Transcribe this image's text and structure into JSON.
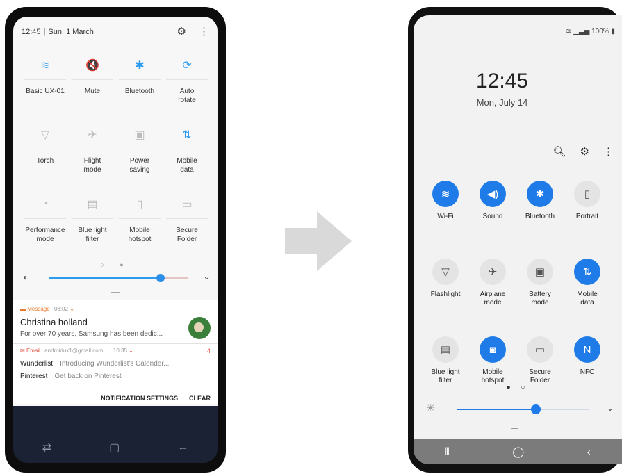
{
  "left_phone": {
    "status_time": "12:45",
    "status_date": "Sun, 1 March",
    "tiles": [
      {
        "label": "Basic UX-01",
        "icon": "wifi-icon",
        "glyph": "≋",
        "active": true
      },
      {
        "label": "Mute",
        "icon": "mute-icon",
        "glyph": "🔇",
        "active": false
      },
      {
        "label": "Bluetooth",
        "icon": "bluetooth-icon",
        "glyph": "✱",
        "active": true
      },
      {
        "label": "Auto\nrotate",
        "icon": "auto-rotate-icon",
        "glyph": "⟳",
        "active": true
      },
      {
        "label": "Torch",
        "icon": "torch-icon",
        "glyph": "▽",
        "active": false
      },
      {
        "label": "Flight\nmode",
        "icon": "airplane-icon",
        "glyph": "✈",
        "active": false
      },
      {
        "label": "Power\nsaving",
        "icon": "power-saving-icon",
        "glyph": "▣",
        "active": false
      },
      {
        "label": "Mobile\ndata",
        "icon": "mobile-data-icon",
        "glyph": "⇅",
        "active": true
      },
      {
        "label": "Performance\nmode",
        "icon": "performance-icon",
        "glyph": "◔",
        "active": false
      },
      {
        "label": "Blue light\nfilter",
        "icon": "blue-light-icon",
        "glyph": "▤",
        "active": false
      },
      {
        "label": "Mobile\nhotspot",
        "icon": "hotspot-icon",
        "glyph": "▯",
        "active": false
      },
      {
        "label": "Secure\nFolder",
        "icon": "secure-folder-icon",
        "glyph": "▭",
        "active": false
      }
    ],
    "brightness": 0.8,
    "notification1": {
      "app": "Message",
      "time": "08:02",
      "title": "Christina holland",
      "body": "For over 70 years, Samsung has been dedic..."
    },
    "notification2": {
      "app": "Email",
      "account": "androidux1@gmail.com",
      "time": "10:35",
      "count": "4",
      "rows": [
        {
          "sender": "Wunderlist",
          "text": "Introducing Wunderlist's Calender..."
        },
        {
          "sender": "Pinterest",
          "text": "Get back on Pinterest"
        }
      ]
    },
    "actions": {
      "settings": "NOTIFICATION SETTINGS",
      "clear": "CLEAR"
    }
  },
  "right_phone": {
    "battery": "100%",
    "clock": "12:45",
    "date": "Mon, July 14",
    "tiles": [
      {
        "label": "Wi-Fi",
        "icon": "wifi-icon",
        "glyph": "≋",
        "active": true
      },
      {
        "label": "Sound",
        "icon": "sound-icon",
        "glyph": "◀)",
        "active": true
      },
      {
        "label": "Bluetooth",
        "icon": "bluetooth-icon",
        "glyph": "✱",
        "active": true
      },
      {
        "label": "Portrait",
        "icon": "portrait-icon",
        "glyph": "▯",
        "active": false
      },
      {
        "label": "Flashlight",
        "icon": "flashlight-icon",
        "glyph": "▽",
        "active": false
      },
      {
        "label": "Airplane\nmode",
        "icon": "airplane-icon",
        "glyph": "✈",
        "active": false
      },
      {
        "label": "Battery\nmode",
        "icon": "battery-icon",
        "glyph": "▣",
        "active": false
      },
      {
        "label": "Mobile\ndata",
        "icon": "mobile-data-icon",
        "glyph": "⇅",
        "active": true
      },
      {
        "label": "Blue light\nfilter",
        "icon": "blue-light-icon",
        "glyph": "▤",
        "active": false
      },
      {
        "label": "Mobile\nhotspot",
        "icon": "hotspot-icon",
        "glyph": "◙",
        "active": true
      },
      {
        "label": "Secure\nFolder",
        "icon": "secure-folder-icon",
        "glyph": "▭",
        "active": false
      },
      {
        "label": "NFC",
        "icon": "nfc-icon",
        "glyph": "N",
        "active": true
      }
    ],
    "brightness": 0.6
  },
  "colors": {
    "accent_old": "#2d9bef",
    "accent_new": "#1f7be8"
  }
}
